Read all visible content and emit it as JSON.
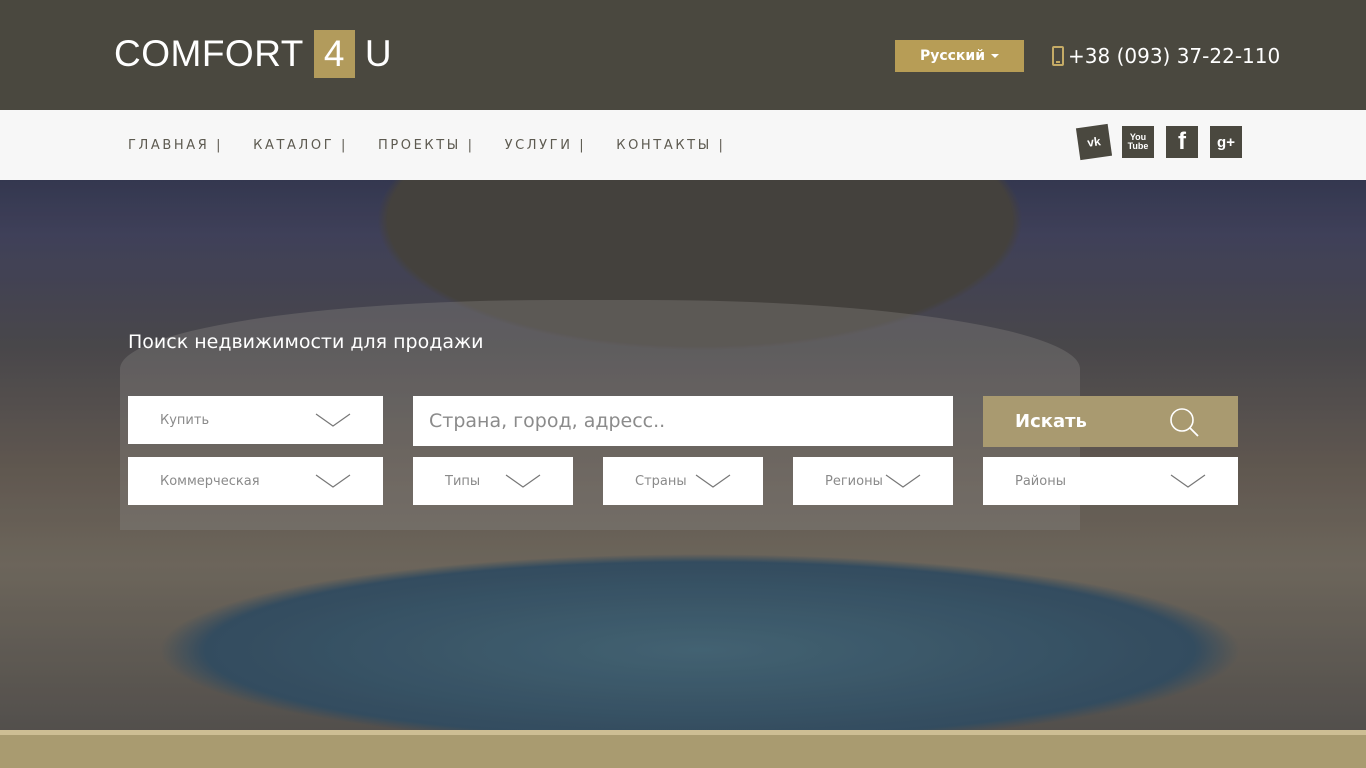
{
  "header": {
    "logo": {
      "text_left": "COMFORT",
      "text_box": "4",
      "text_right": "U"
    },
    "language": {
      "selected": "Русский"
    },
    "phone": "+38 (093) 37-22-110"
  },
  "nav": {
    "items": [
      {
        "label": "ГЛАВНАЯ |"
      },
      {
        "label": "КАТАЛОГ |"
      },
      {
        "label": "ПРОЕКТЫ |"
      },
      {
        "label": "УСЛУГИ |"
      },
      {
        "label": "КОНТАКТЫ |"
      }
    ]
  },
  "socials": {
    "vk": "vk",
    "youtube_line1": "You",
    "youtube_line2": "Tube",
    "facebook": "f",
    "googleplus": "g+"
  },
  "search": {
    "title": "Поиск недвижимости для продажи",
    "deal_type": "Купить",
    "query_placeholder": "Страна, город, адресс..",
    "button_label": "Искать",
    "property_category": "Коммерческая",
    "types": "Типы",
    "countries": "Страны",
    "regions": "Регионы",
    "districts": "Районы"
  },
  "colors": {
    "header_bg": "#4a483f",
    "accent": "#b79d56",
    "search_button": "#a99a70",
    "nav_bg": "#f7f7f7"
  }
}
